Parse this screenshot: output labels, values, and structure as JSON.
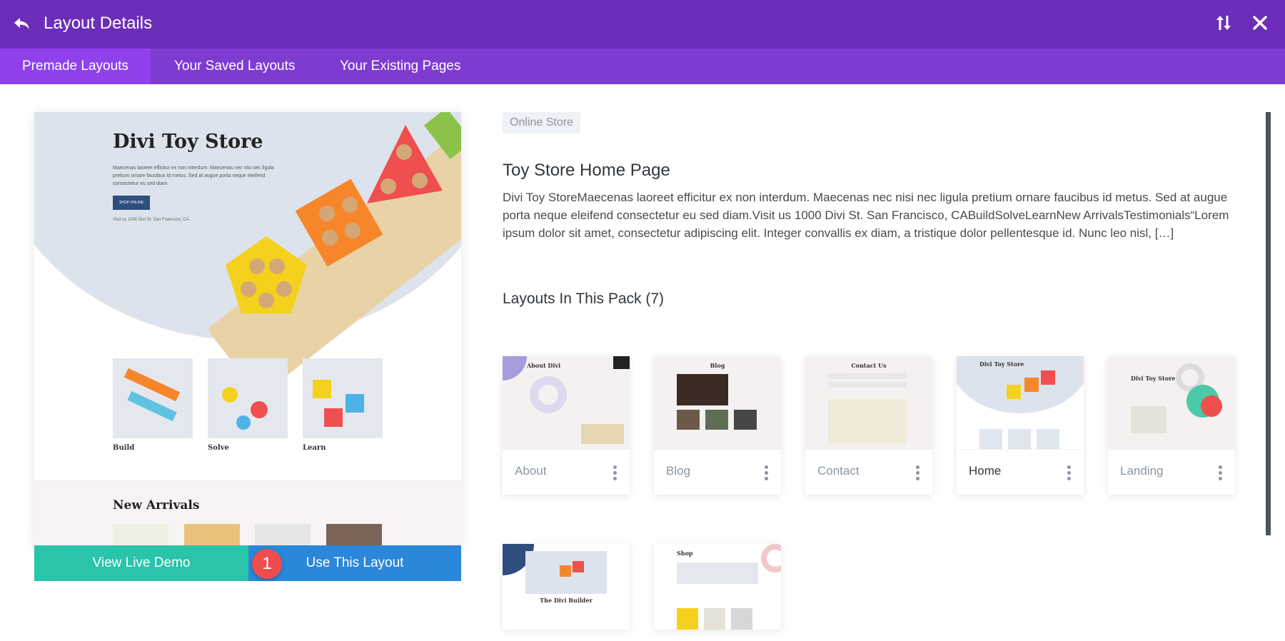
{
  "header": {
    "title": "Layout Details",
    "back_icon": "back-arrow-icon",
    "sort_icon": "sort-arrows-icon",
    "close_icon": "close-icon",
    "bg_color": "#6c2eb9"
  },
  "tabs": [
    {
      "label": "Premade Layouts",
      "active": true
    },
    {
      "label": "Your Saved Layouts",
      "active": false
    },
    {
      "label": "Your Existing Pages",
      "active": false
    }
  ],
  "preview": {
    "store_title": "Divi Toy Store",
    "intro_text": "Maecenas laoreet efficitur ex non interdum. Maecenas nec nisi nec ligula pretium ornare faucibus id metus. Sed at augue porta neque eleifend consectetur eu sed diam.",
    "shop_button": "SHOP ONLINE",
    "address": "Visit us 1000 Divi St. San Francisco, CA",
    "products": [
      "Build",
      "Solve",
      "Learn"
    ],
    "new_arrivals": "New Arrivals"
  },
  "actions": {
    "view_demo": "View Live Demo",
    "use_layout": "Use This Layout",
    "step_number": "1"
  },
  "details": {
    "category": "Online Store",
    "title": "Toy Store Home Page",
    "description": "Divi Toy StoreMaecenas laoreet efficitur ex non interdum. Maecenas nec nisi nec ligula pretium ornare faucibus id metus. Sed at augue porta neque eleifend consectetur eu sed diam.Visit us 1000 Divi St. San Francisco, CABuildSolveLearnNew ArrivalsTestimonials“Lorem ipsum dolor sit amet, consectetur adipiscing elit. Integer convallis ex diam, a tristique dolor pellentesque id. Nunc leo nisl, […]",
    "pack_heading": "Layouts In This Pack (7)"
  },
  "pack_layouts": [
    {
      "name": "About",
      "thumb_heading": "About Divi",
      "current": false
    },
    {
      "name": "Blog",
      "thumb_heading": "Blog",
      "current": false
    },
    {
      "name": "Contact",
      "thumb_heading": "Contact Us",
      "current": false
    },
    {
      "name": "Home",
      "thumb_heading": "Divi Toy Store",
      "current": true
    },
    {
      "name": "Landing",
      "thumb_heading": "Divi Toy Store",
      "current": false
    },
    {
      "name": "",
      "thumb_heading": "The Divi Builder",
      "current": false
    },
    {
      "name": "",
      "thumb_heading": "Shop",
      "current": false
    }
  ],
  "colors": {
    "topbar": "#6c2eb9",
    "tabbar": "#7e3bd0",
    "active_tab": "#8f42ec",
    "demo_button": "#29c4a9",
    "use_button": "#2b87da",
    "badge": "#ef4d4d"
  }
}
